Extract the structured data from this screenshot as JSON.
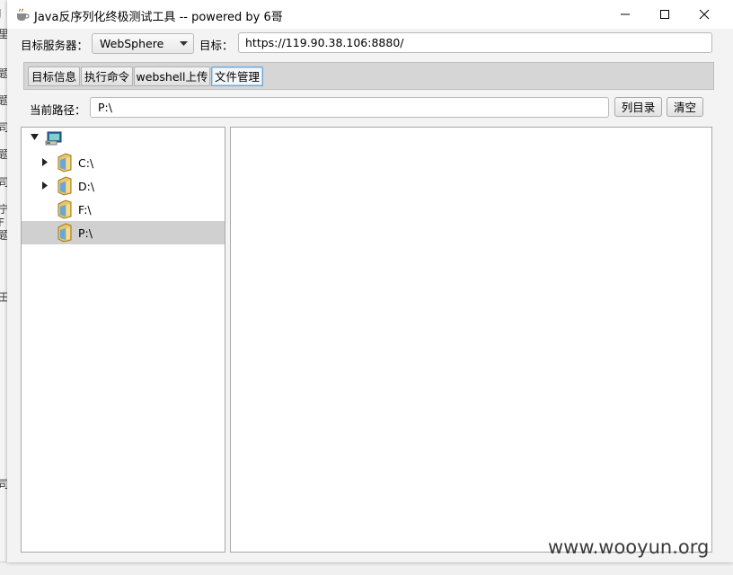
{
  "background": {
    "left_fragments": [
      "J",
      "里",
      "题",
      "题",
      "司",
      "题",
      "司",
      "宁F",
      "题",
      "田",
      "司"
    ]
  },
  "window": {
    "title": "Java反序列化终极测试工具  -- powered by 6哥",
    "buttons": {
      "minimize": "minimize",
      "maximize": "maximize",
      "close": "close"
    }
  },
  "toolbar": {
    "server_label": "目标服务器：",
    "server_value": "WebSphere",
    "target_label": "目标：",
    "target_value": "https://119.90.38.106:8880/"
  },
  "tabs": [
    {
      "label": "目标信息",
      "active": false
    },
    {
      "label": "执行命令",
      "active": false
    },
    {
      "label": "webshell上传",
      "active": false
    },
    {
      "label": "文件管理",
      "active": true
    }
  ],
  "file_manager": {
    "path_label": "当前路径：",
    "path_value": "P:\\",
    "list_button": "列目录",
    "clear_button": "清空",
    "tree": {
      "root_icon": "computer-icon",
      "drives": [
        {
          "label": "C:\\",
          "expandable": true,
          "selected": false
        },
        {
          "label": "D:\\",
          "expandable": true,
          "selected": false
        },
        {
          "label": "F:\\",
          "expandable": false,
          "selected": false
        },
        {
          "label": "P:\\",
          "expandable": false,
          "selected": true
        }
      ]
    }
  },
  "watermark": "www.wooyun.org",
  "colors": {
    "selection": "#d0d0d0",
    "active_tab_border": "#6ea7d8"
  }
}
